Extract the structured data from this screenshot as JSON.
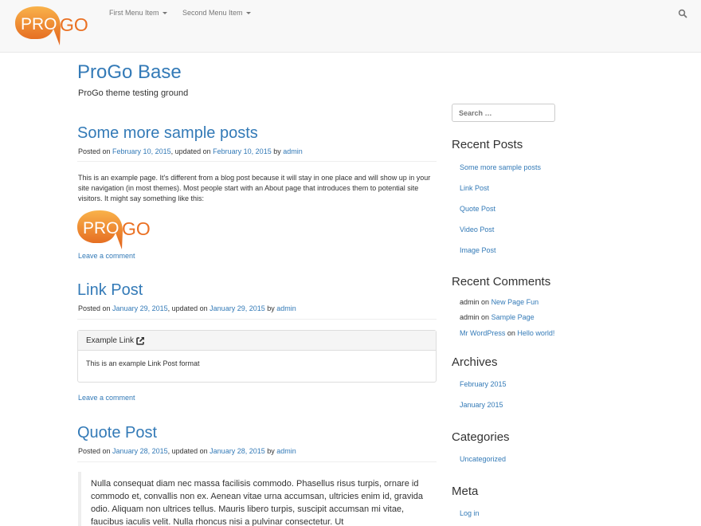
{
  "navbar": {
    "logo_text_pro": "PRO",
    "logo_text_go": "GO",
    "menu": [
      {
        "label": "First Menu Item"
      },
      {
        "label": "Second Menu Item"
      }
    ]
  },
  "site": {
    "title": "ProGo Base",
    "description": "ProGo theme testing ground"
  },
  "posts": [
    {
      "title": "Some more sample posts",
      "posted_on": "Posted on",
      "date": "February 10, 2015",
      "updated_on": ", updated on",
      "updated_date": "February 10, 2015",
      "by": "by",
      "author": "admin",
      "body": "This is an example page. It's different from a blog post because it will stay in one place and will show up in your site navigation (in most themes). Most people start with an About page that introduces them to potential site visitors. It might say something like this:",
      "comment_link": "Leave a comment"
    },
    {
      "title": "Link Post",
      "posted_on": "Posted on",
      "date": "January 29, 2015",
      "updated_on": ", updated on",
      "updated_date": "January 29, 2015",
      "by": "by",
      "author": "admin",
      "panel_heading": "Example Link",
      "panel_body": "This is an example Link Post format",
      "comment_link": "Leave a comment"
    },
    {
      "title": "Quote Post",
      "posted_on": "Posted on",
      "date": "January 28, 2015",
      "updated_on": ", updated on",
      "updated_date": "January 28, 2015",
      "by": "by",
      "author": "admin",
      "quote": "Nulla consequat diam nec massa facilisis commodo. Phasellus risus turpis, ornare id commodo et, convallis non ex. Aenean vitae urna accumsan, ultricies enim id, gravida odio. Aliquam non ultrices tellus. Mauris libero turpis, suscipit accumsan mi vitae, faucibus iaculis velit. Nulla rhoncus nisi a pulvinar consectetur. Ut"
    }
  ],
  "sidebar": {
    "search_placeholder": "Search …",
    "recent_posts_title": "Recent Posts",
    "recent_posts": [
      "Some more sample posts",
      "Link Post",
      "Quote Post",
      "Video Post",
      "Image Post"
    ],
    "recent_comments_title": "Recent Comments",
    "recent_comments": [
      {
        "author": "admin",
        "on": "on",
        "post": "New Page Fun"
      },
      {
        "author": "admin",
        "on": "on",
        "post": "Sample Page"
      },
      {
        "author": "Mr WordPress",
        "on": "on",
        "post": "Hello world!"
      }
    ],
    "archives_title": "Archives",
    "archives": [
      "February 2015",
      "January 2015"
    ],
    "categories_title": "Categories",
    "categories": [
      "Uncategorized"
    ],
    "meta_title": "Meta",
    "meta": [
      "Log in"
    ]
  },
  "colors": {
    "link": "#337ab7",
    "logo_orange": "#f08a24",
    "navbar_bg": "#f8f8f8"
  },
  "icons": {
    "search": "search-icon",
    "external_link": "external-link-icon",
    "caret": "caret-down-icon"
  }
}
